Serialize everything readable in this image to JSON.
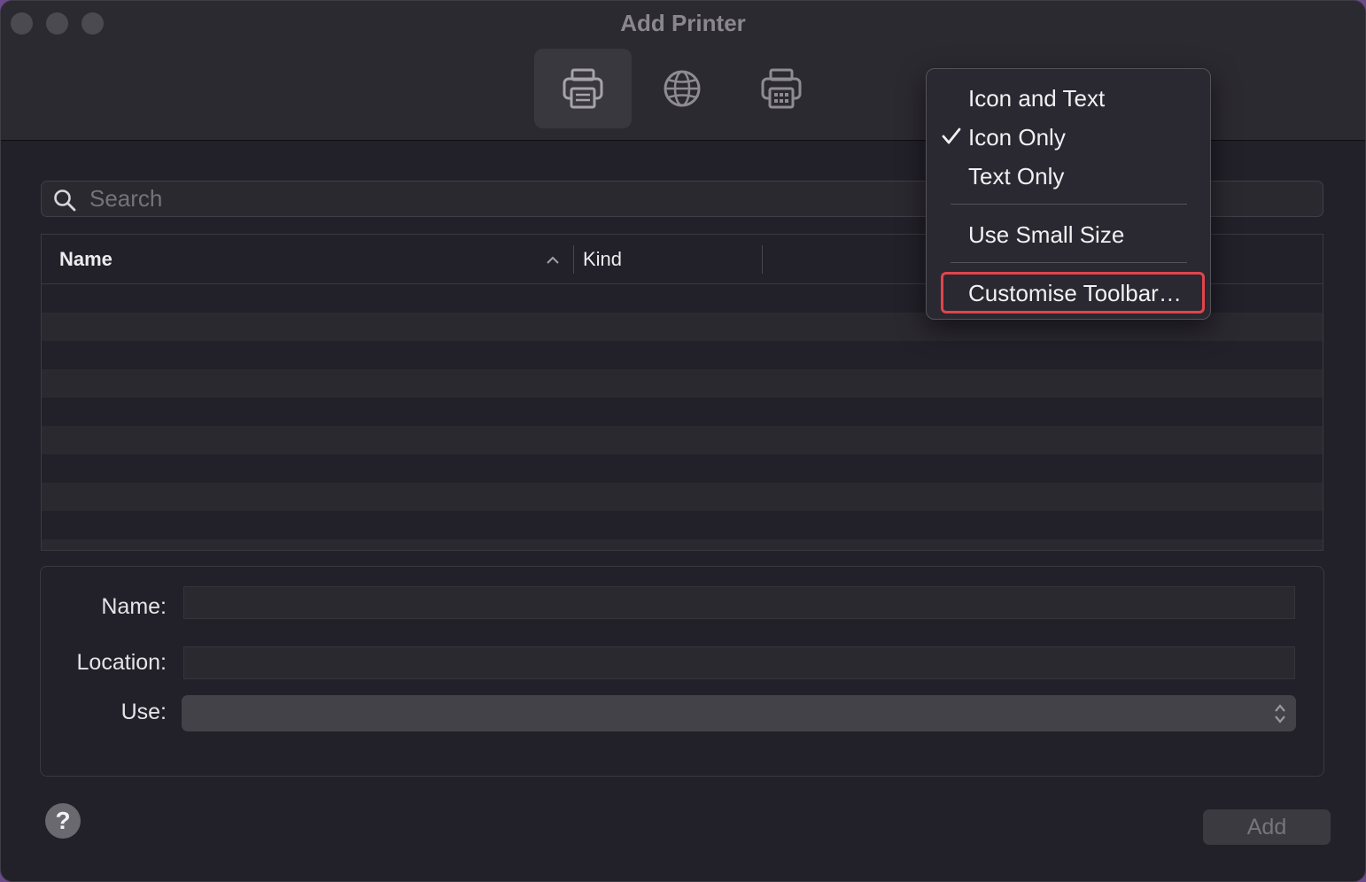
{
  "window": {
    "title": "Add Printer"
  },
  "toolbar": {
    "buttons": [
      {
        "name": "default-printers",
        "icon": "printer-icon",
        "selected": true
      },
      {
        "name": "ip-printers",
        "icon": "globe-icon",
        "selected": false
      },
      {
        "name": "windows-printers",
        "icon": "printer-building-icon",
        "selected": false
      }
    ]
  },
  "search": {
    "placeholder": "Search",
    "value": ""
  },
  "table": {
    "columns": [
      {
        "label": "Name",
        "sort": "ascending"
      },
      {
        "label": "Kind"
      }
    ],
    "rows": []
  },
  "form": {
    "name_label": "Name:",
    "location_label": "Location:",
    "use_label": "Use:",
    "name_value": "",
    "location_value": "",
    "use_value": ""
  },
  "footer": {
    "help_label": "?",
    "add_label": "Add",
    "add_enabled": false
  },
  "context_menu": {
    "items": [
      {
        "label": "Icon and Text",
        "checked": false
      },
      {
        "label": "Icon Only",
        "checked": true
      },
      {
        "label": "Text Only",
        "checked": false
      },
      {
        "label": "Use Small Size",
        "checked": false
      },
      {
        "label": "Customise Toolbar…",
        "checked": false,
        "highlighted": true
      }
    ],
    "highlight_color": "#e1444c"
  }
}
